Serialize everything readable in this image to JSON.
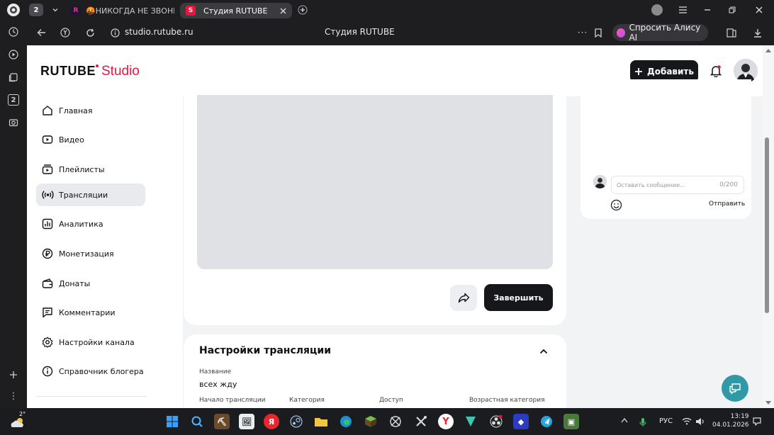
{
  "browser": {
    "tab_counter": "2",
    "tabs": [
      {
        "label": "🤬НИКОГДА НЕ ЗВОНИ",
        "favicon": "R"
      },
      {
        "label": "Студия RUTUBE",
        "favicon": "S"
      }
    ],
    "address": "studio.rutube.ru",
    "page_title": "Студия RUTUBE",
    "alice_label": "Спросить Алису AI",
    "left_rail_badge": "2"
  },
  "header": {
    "logo_main": "RUTUBE",
    "logo_studio": "Studio",
    "add_label": "Добавить"
  },
  "sidebar": {
    "items": [
      {
        "label": "Главная",
        "icon": "home-icon"
      },
      {
        "label": "Видео",
        "icon": "video-icon"
      },
      {
        "label": "Плейлисты",
        "icon": "playlist-icon"
      },
      {
        "label": "Трансляции",
        "icon": "broadcast-icon"
      },
      {
        "label": "Аналитика",
        "icon": "analytics-icon"
      },
      {
        "label": "Монетизация",
        "icon": "ruble-icon"
      },
      {
        "label": "Донаты",
        "icon": "wallet-icon"
      },
      {
        "label": "Комментарии",
        "icon": "comment-icon"
      },
      {
        "label": "Настройки канала",
        "icon": "gear-icon"
      },
      {
        "label": "Справочник блогера",
        "icon": "info-icon"
      }
    ],
    "active": "Трансляции"
  },
  "stream": {
    "finish_label": "Завершить"
  },
  "chat": {
    "placeholder": "Оставить сообщение...",
    "counter": "0/200",
    "send_label": "Отправить"
  },
  "settings": {
    "title": "Настройки трансляции",
    "name_label": "Название",
    "name_value": "всех жду",
    "columns": [
      "Начало трансляции",
      "Категория",
      "Доступ",
      "Возрастная категория"
    ]
  },
  "taskbar": {
    "weather": "2°",
    "lang": "РУС",
    "time": "13:19",
    "date": "04.01.2026"
  },
  "colors": {
    "accent_red": "#ed143b",
    "dark_button": "#16171b",
    "help_teal": "#2f9aa6"
  }
}
